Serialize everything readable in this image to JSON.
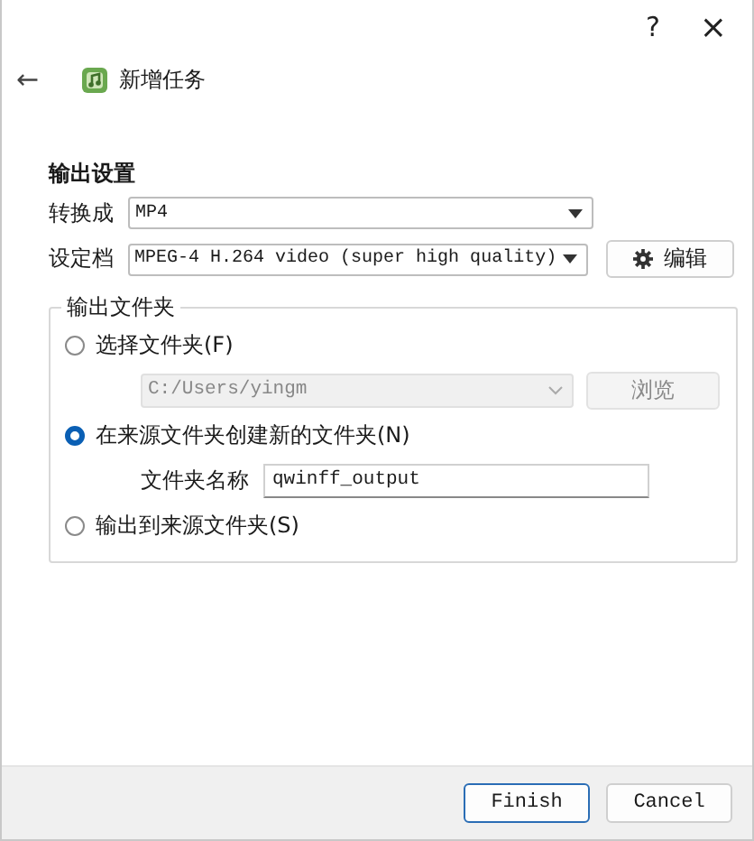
{
  "title_bar": {
    "help": "?",
    "close": "×"
  },
  "header": {
    "back": "←",
    "title": "新增任务"
  },
  "section_title": "输出设置",
  "convert_to": {
    "label": "转换成",
    "value": "MP4"
  },
  "preset": {
    "label": "设定档",
    "value": "MPEG-4 H.264 video (super high quality)",
    "edit_button": "编辑"
  },
  "output_folder": {
    "title": "输出文件夹",
    "options": [
      {
        "kind": "choose",
        "label": "选择文件夹(F)",
        "selected": false,
        "path": "C:/Users/yingm",
        "browse": "浏览",
        "disabled": true
      },
      {
        "kind": "new",
        "label": "在来源文件夹创建新的文件夹(N)",
        "selected": true,
        "name_label": "文件夹名称",
        "name_value": "qwinff_output"
      },
      {
        "kind": "plain",
        "label": "输出到来源文件夹(S)",
        "selected": false
      }
    ]
  },
  "buttons": [
    {
      "label": "Finish",
      "default": true
    },
    {
      "label": "Cancel",
      "default": false
    }
  ]
}
